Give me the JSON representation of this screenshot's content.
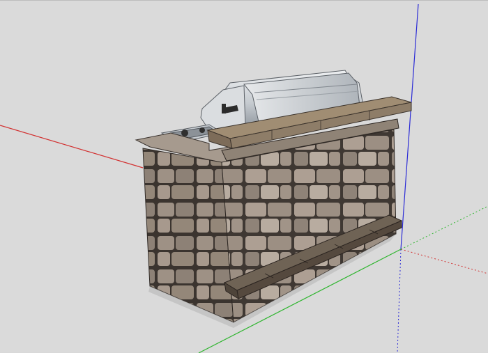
{
  "viewport": {
    "background": "#dadada",
    "axis_colors": {
      "red": "#d23030",
      "green": "#2fb52f",
      "blue": "#2a2ad6"
    }
  },
  "model": {
    "materials": {
      "stone_light": "#b3a89c",
      "stone_mid": "#9d9084",
      "stone_dark": "#7b6f66",
      "mortar": "#4a423c",
      "cap_top": "#a08d73",
      "cap_face": "#8e7d68",
      "bench_top": "#6f6355",
      "grill_steel": "#c9cdd2",
      "grill_shadow": "#8f959c"
    }
  }
}
